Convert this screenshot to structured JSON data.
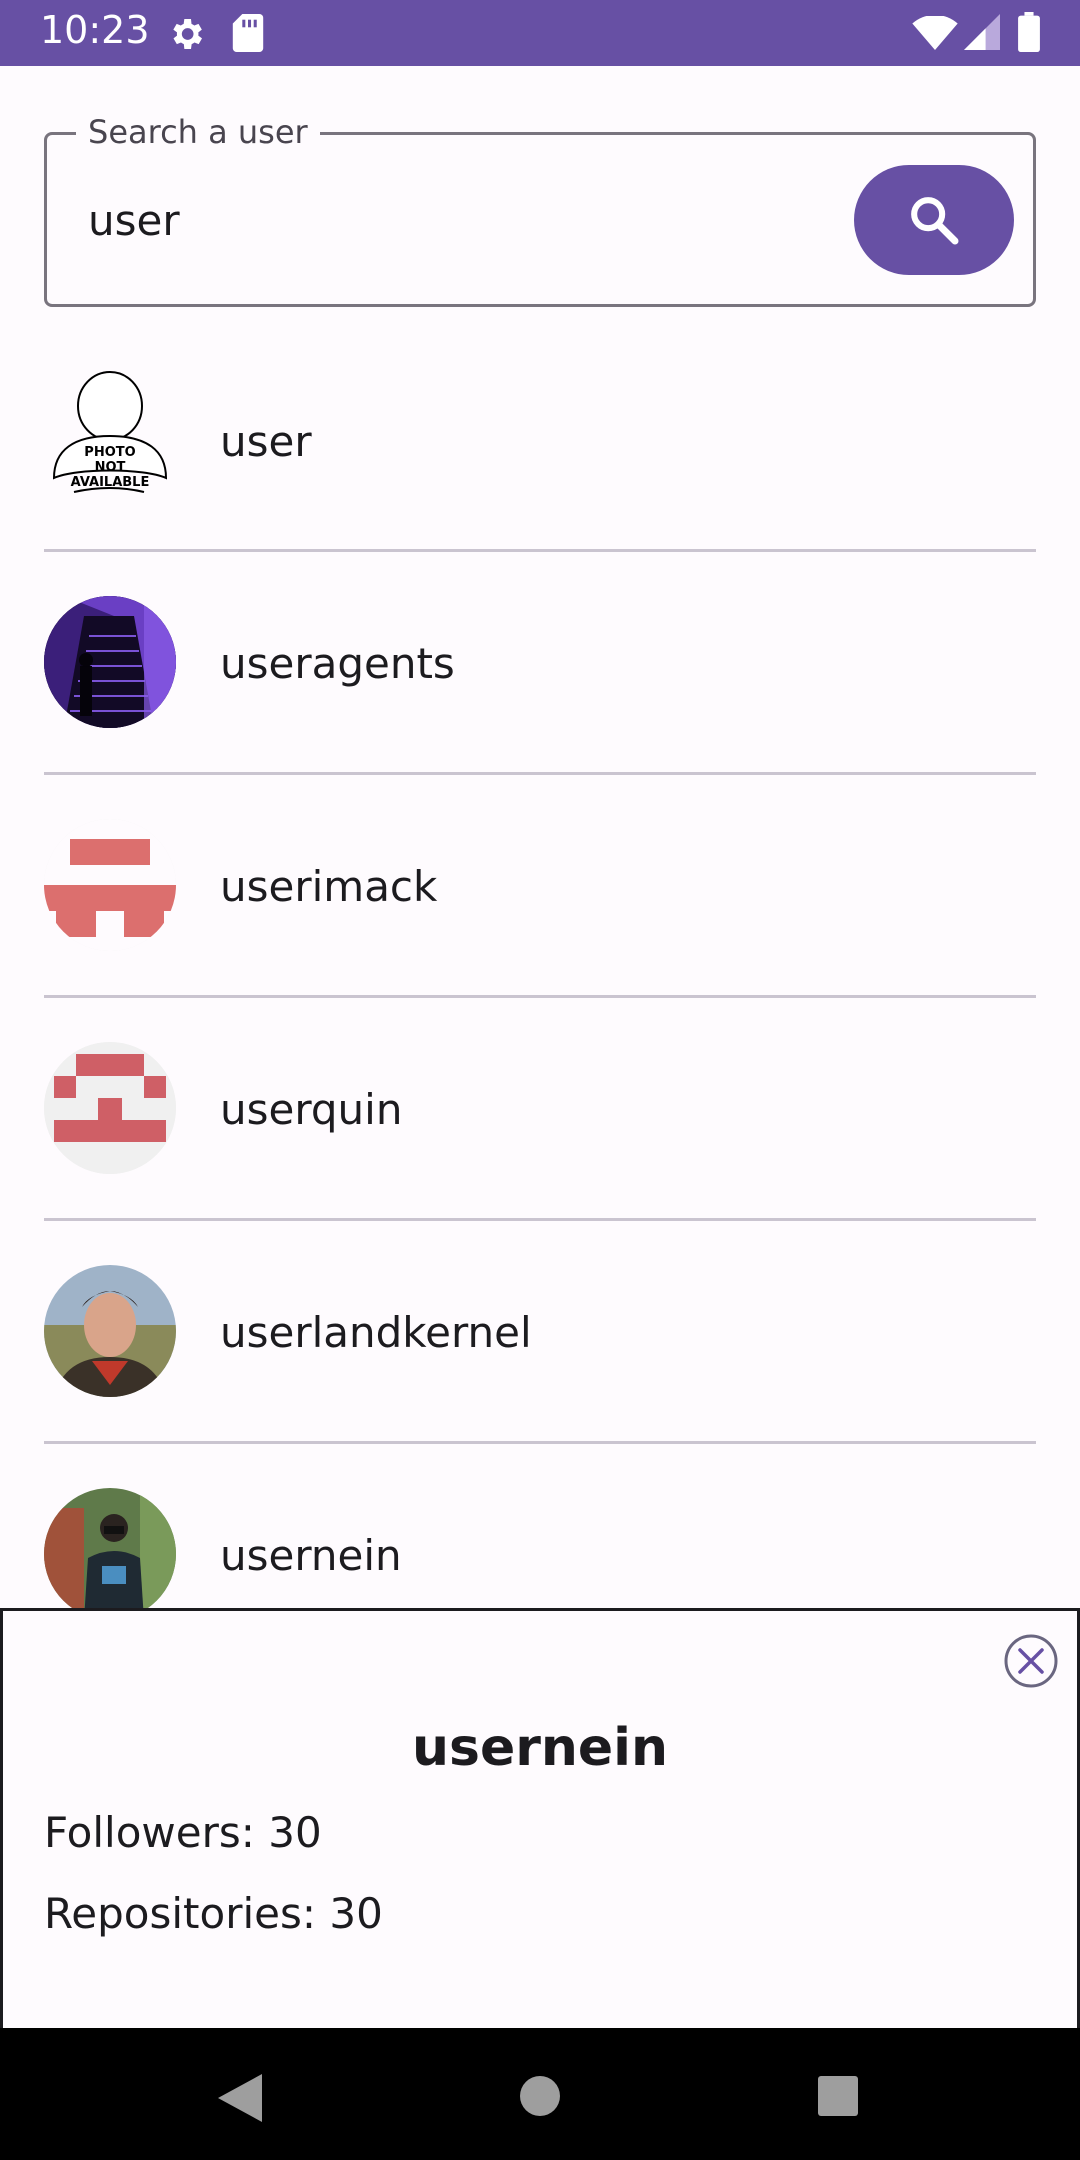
{
  "status_bar": {
    "time": "10:23",
    "icons": [
      "settings-icon",
      "sd-card-icon",
      "wifi-icon",
      "signal-icon",
      "battery-icon"
    ],
    "color": "#6750a4"
  },
  "search": {
    "label": "Search a user",
    "value": "user",
    "button_icon": "search-icon"
  },
  "results": [
    {
      "username": "user"
    },
    {
      "username": "useragents"
    },
    {
      "username": "userimack"
    },
    {
      "username": "userquin"
    },
    {
      "username": "userlandkernel"
    },
    {
      "username": "usernein"
    }
  ],
  "placeholder_avatar_text": [
    "PHOTO",
    "NOT",
    "AVAILABLE"
  ],
  "detail_sheet": {
    "title": "usernein",
    "followers": "Followers: 30",
    "repositories": "Repositories: 30",
    "close_icon": "close-icon"
  },
  "nav_bar": {
    "icons": [
      "back-icon",
      "home-icon",
      "recents-icon"
    ]
  },
  "accent_color": "#6750a4"
}
